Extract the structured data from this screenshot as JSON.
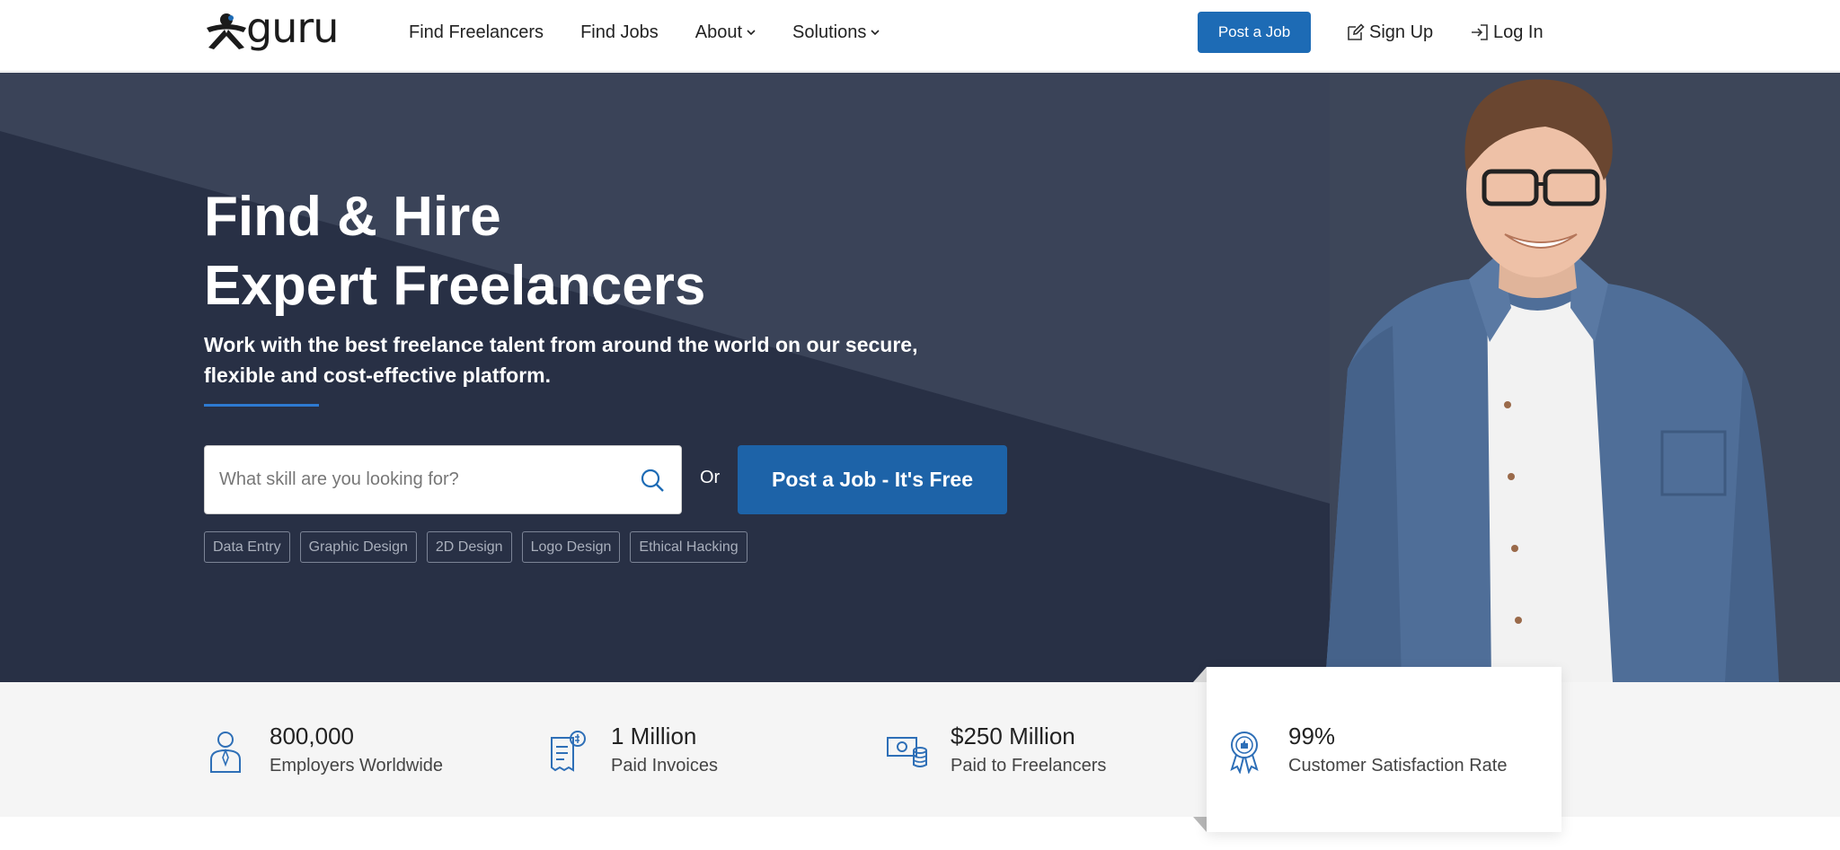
{
  "brand": {
    "name": "guru",
    "accent": "#1d6bb5",
    "hero_bg": "#2a3348"
  },
  "header": {
    "nav": [
      {
        "label": "Find Freelancers",
        "dropdown": false
      },
      {
        "label": "Find Jobs",
        "dropdown": false
      },
      {
        "label": "About",
        "dropdown": true
      },
      {
        "label": "Solutions",
        "dropdown": true
      }
    ],
    "post_job_label": "Post a Job",
    "signup_label": "Sign Up",
    "signup_icon": "edit-icon",
    "login_label": "Log In",
    "login_icon": "login-icon"
  },
  "hero": {
    "title_line1": "Find & Hire",
    "title_line2": "Expert Freelancers",
    "subtitle": "Work with the best freelance talent from around the world on our secure, flexible and cost-effective platform.",
    "search_placeholder": "What skill are you looking for?",
    "or_label": "Or",
    "cta_label": "Post a Job - It's Free",
    "tags": [
      "Data Entry",
      "Graphic Design",
      "2D Design",
      "Logo Design",
      "Ethical Hacking"
    ]
  },
  "stats": [
    {
      "number": "800,000",
      "label": "Employers Worldwide",
      "icon": "employer-icon"
    },
    {
      "number": "1 Million",
      "label": "Paid Invoices",
      "icon": "invoice-icon"
    },
    {
      "number": "$250 Million",
      "label": "Paid to Freelancers",
      "icon": "money-icon"
    },
    {
      "number": "99%",
      "label": "Customer Satisfaction Rate",
      "icon": "award-icon"
    }
  ]
}
